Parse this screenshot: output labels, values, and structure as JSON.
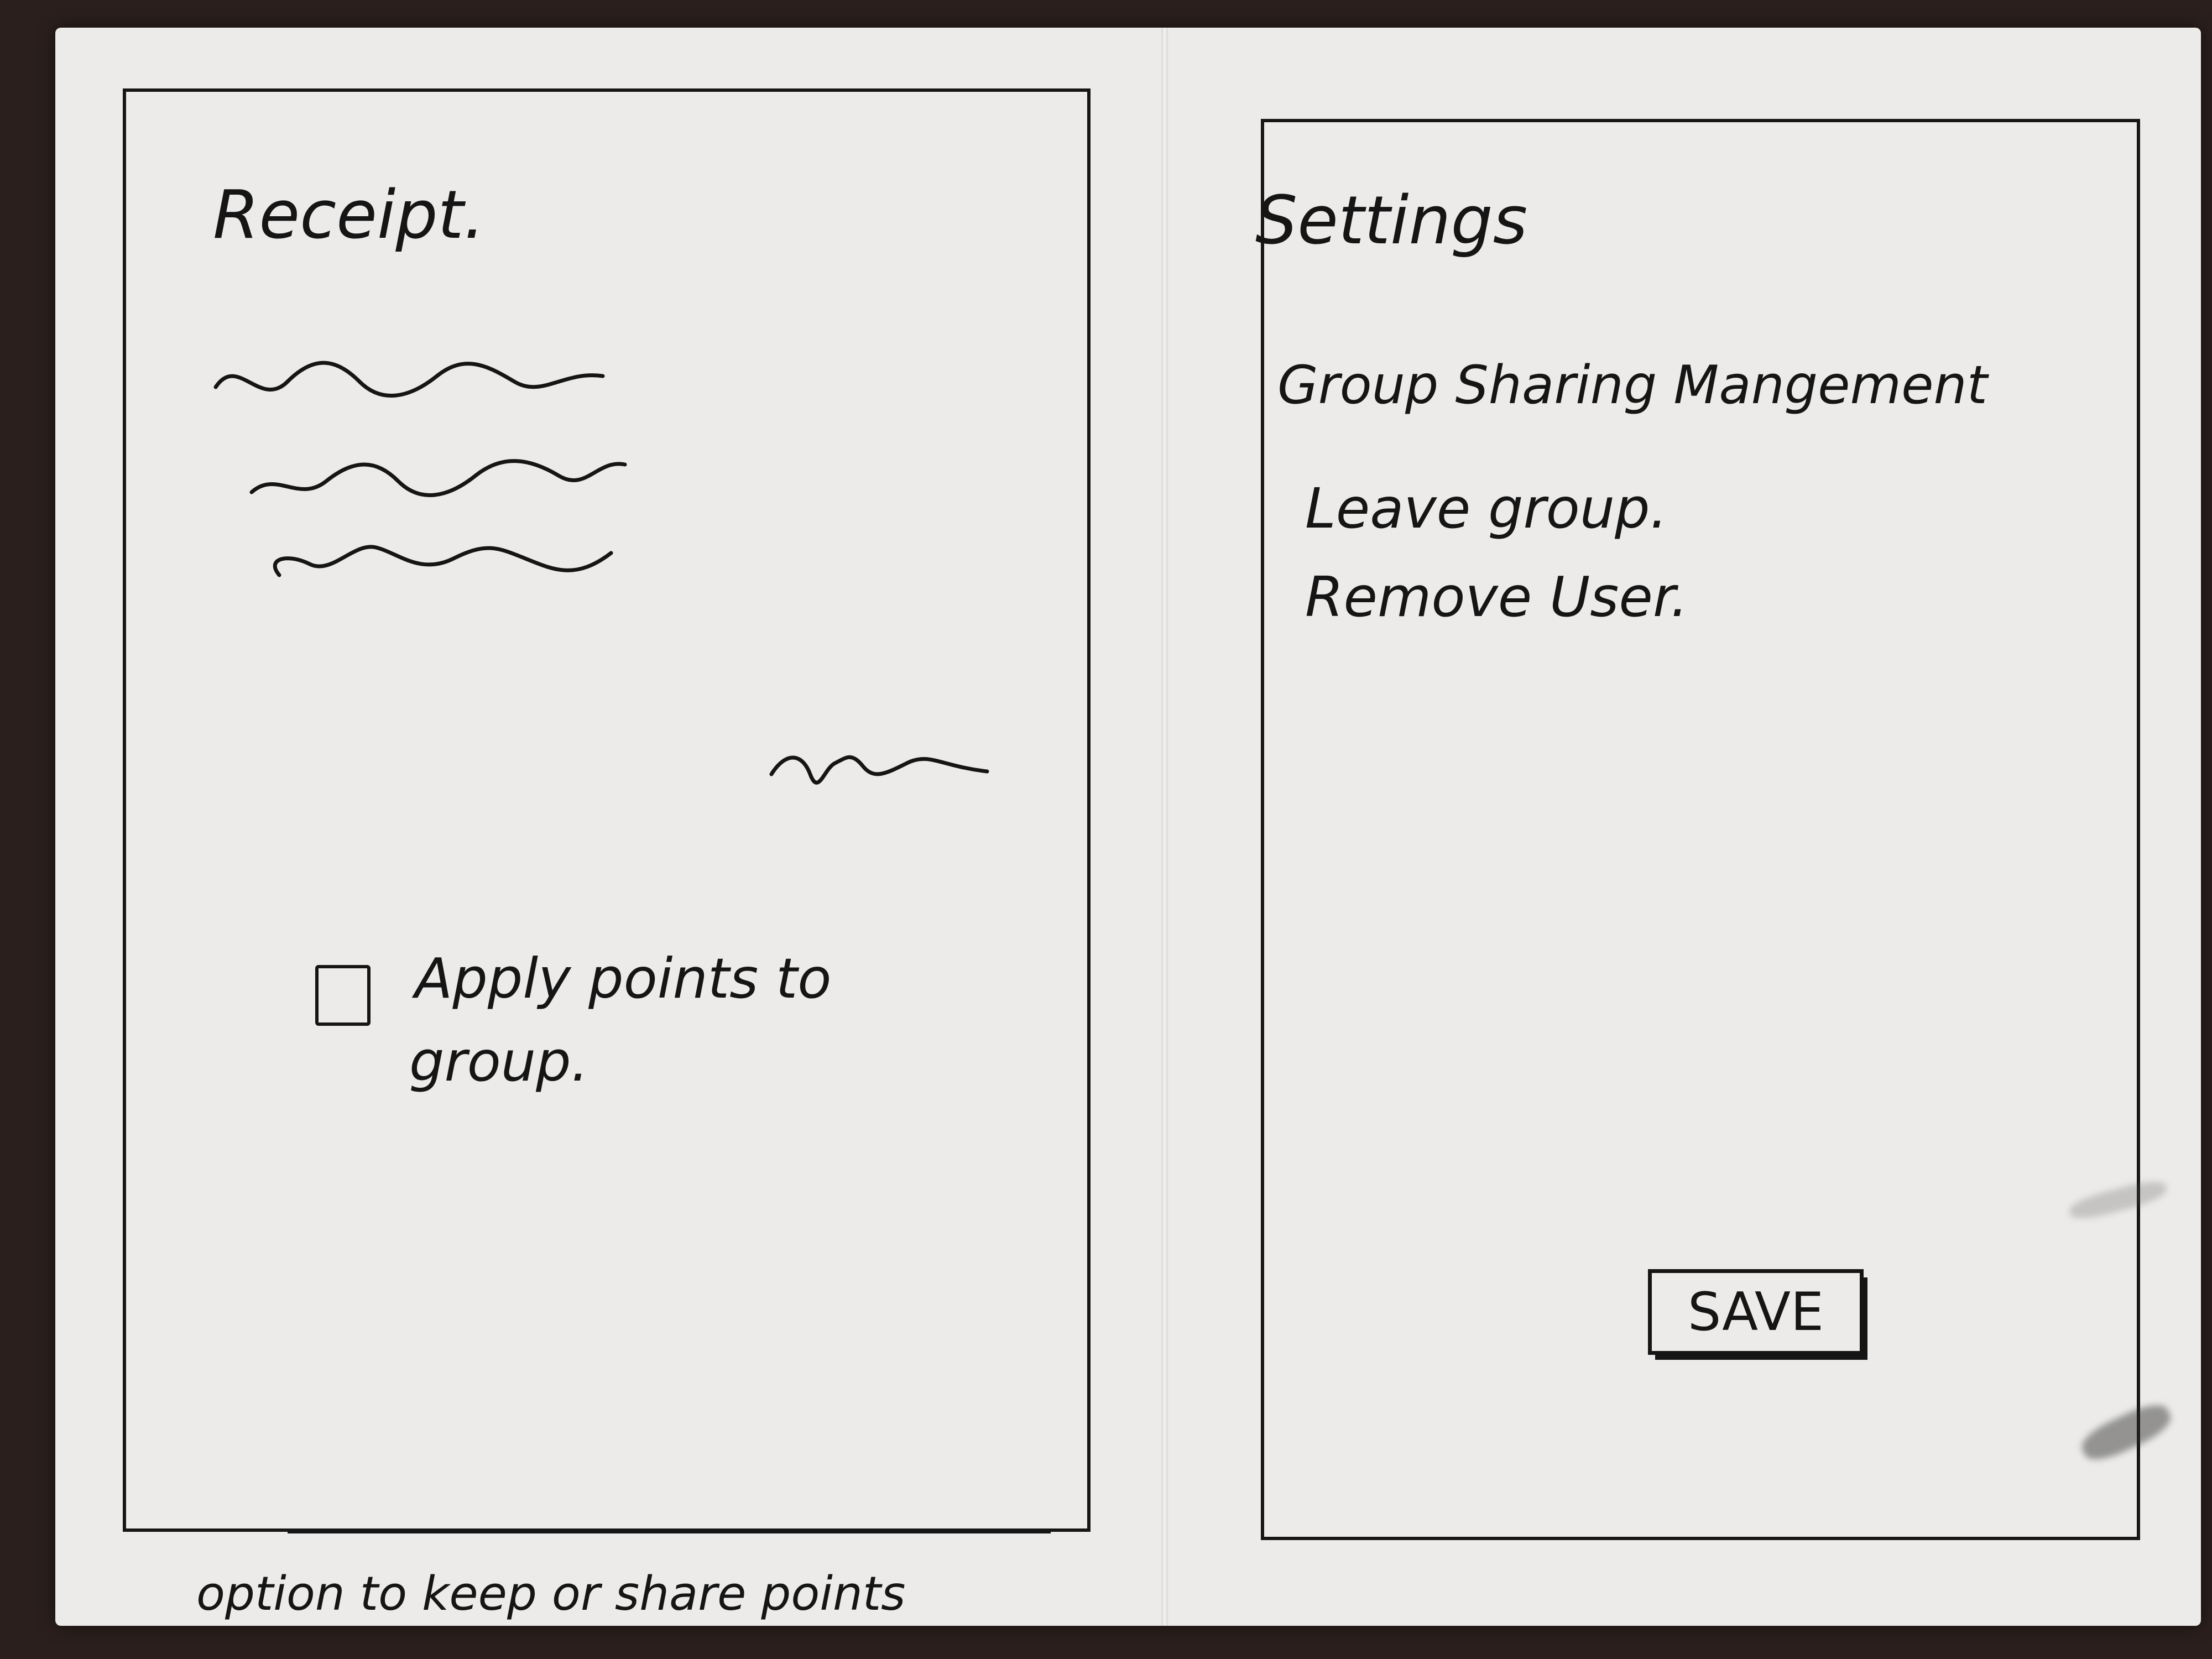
{
  "receipt": {
    "title": "Receipt.",
    "checkbox_label_line1": "Apply points to",
    "checkbox_label_line2": "group.",
    "checkbox_checked": false
  },
  "settings": {
    "title": "Settings",
    "items": [
      {
        "label": "Group Sharing Mangement"
      },
      {
        "label": "Leave group."
      },
      {
        "label": "Remove User."
      }
    ],
    "save_label": "SAVE"
  },
  "annotation": "option to keep or share points"
}
